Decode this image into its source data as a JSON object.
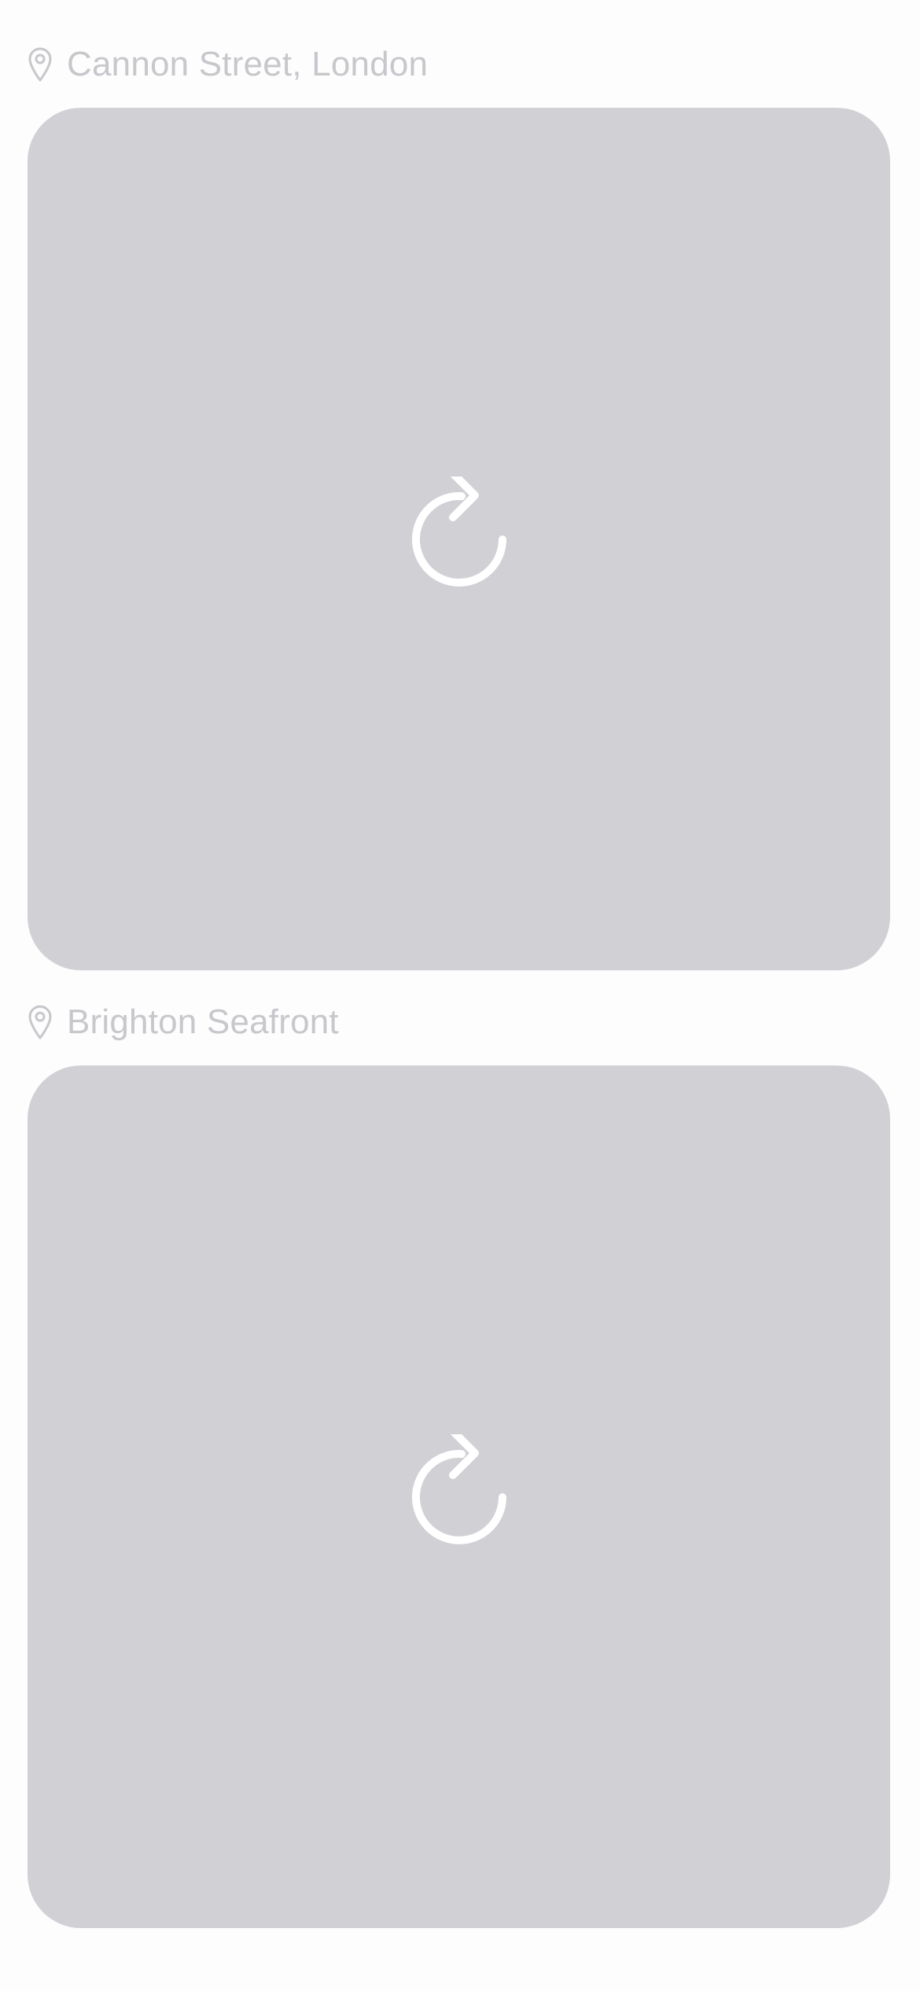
{
  "locations": [
    {
      "name": "Cannon Street, London",
      "icon": "location-pin-icon",
      "placeholder_icon": "reload-icon"
    },
    {
      "name": "Brighton Seafront",
      "icon": "location-pin-icon",
      "placeholder_icon": "reload-icon"
    }
  ],
  "colors": {
    "background": "#fdfdfd",
    "label": "#c7c7cc",
    "card": "#d1d0d5",
    "icon": "#ffffff"
  }
}
